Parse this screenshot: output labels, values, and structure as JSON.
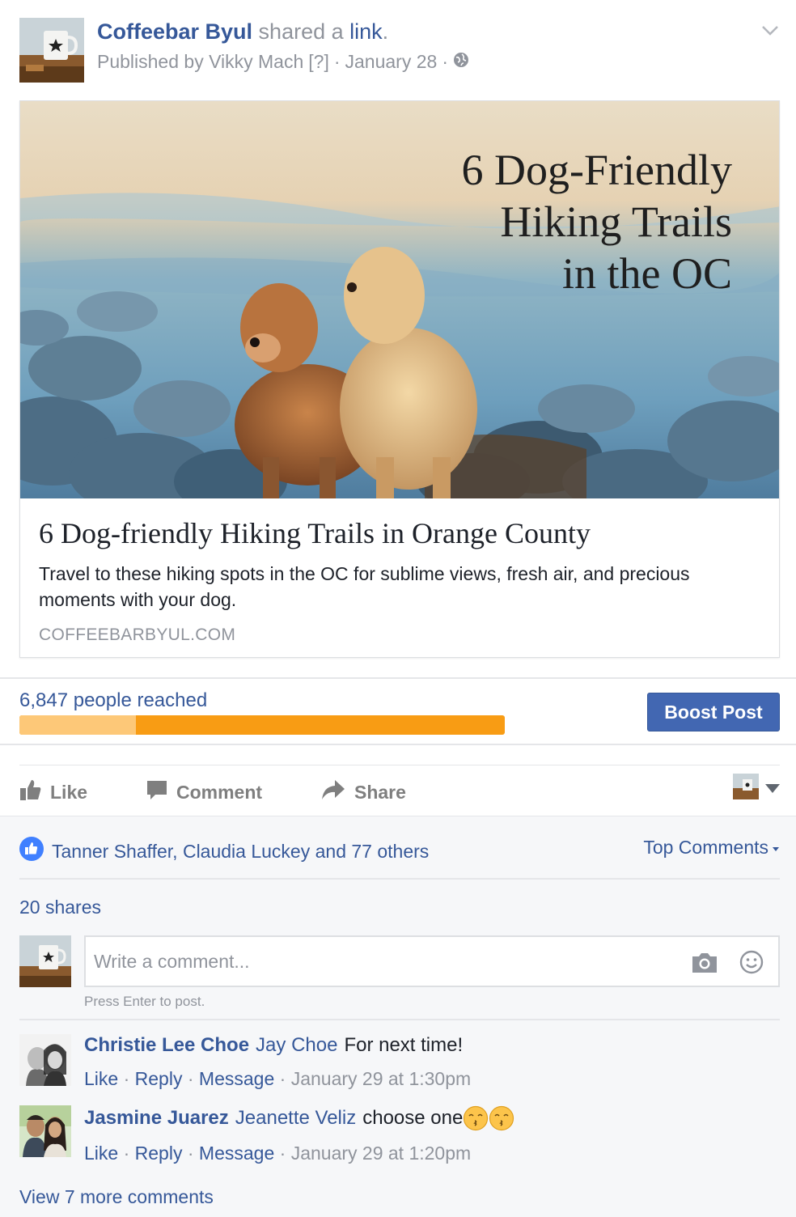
{
  "post": {
    "page_name": "Coffeebar Byul",
    "action_text": " shared a ",
    "action_link": "link",
    "action_end": ".",
    "published_by": "Published by Vikky Mach",
    "help_marker": "[?]",
    "date": "January 28",
    "dot": "·"
  },
  "link_card": {
    "image_title_lines": [
      "6 Dog-Friendly",
      "Hiking Trails",
      "in the OC"
    ],
    "title": "6 Dog-friendly Hiking Trails in Orange County",
    "description": "Travel to these hiking spots in the OC for sublime views, fresh air, and precious moments with your dog.",
    "domain": "COFFEEBARBYUL.COM"
  },
  "reach": {
    "text": "6,847 people reached",
    "organic_fraction": 0.24,
    "boost_label": "Boost Post",
    "colors": {
      "organic": "#fdc878",
      "paid": "#f89c14",
      "button": "#4267b2"
    }
  },
  "actions": {
    "like": "Like",
    "comment": "Comment",
    "share": "Share"
  },
  "reactions": {
    "likers": "Tanner Shaffer, Claudia Luckey and 77 others",
    "sort_label": "Top Comments"
  },
  "shares": "20 shares",
  "comment_box": {
    "placeholder": "Write a comment...",
    "hint": "Press Enter to post."
  },
  "comments": [
    {
      "author": "Christie Lee Choe",
      "tag": "Jay Choe",
      "text": "For next time!",
      "like": "Like",
      "reply": "Reply",
      "message": "Message",
      "time": "January 29 at 1:30pm"
    },
    {
      "author": "Jasmine Juarez",
      "tag": "Jeanette Veliz",
      "text": "choose one",
      "emoji": "kissing-face-emoji",
      "like": "Like",
      "reply": "Reply",
      "message": "Message",
      "time": "January 29 at 1:20pm"
    }
  ],
  "more_comments": "View 7 more comments"
}
